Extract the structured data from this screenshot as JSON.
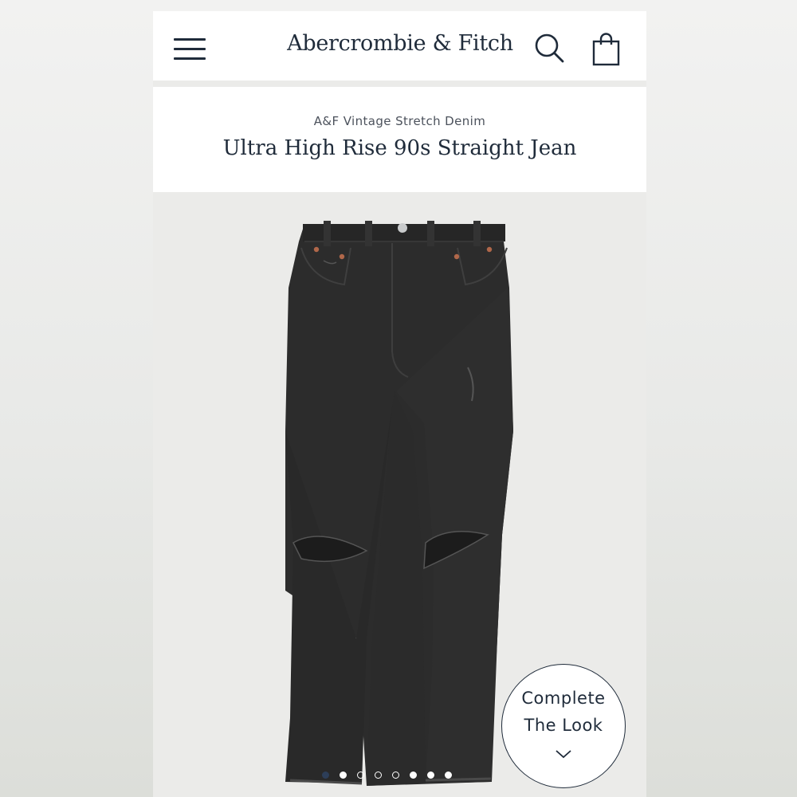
{
  "header": {
    "brand": "Abercrombie & Fitch",
    "icons": [
      "hamburger-menu-icon",
      "search-icon",
      "shopping-bag-icon"
    ]
  },
  "product": {
    "collection": "A&F Vintage Stretch Denim",
    "title": "Ultra High Rise 90s Straight Jean"
  },
  "complete_look": {
    "line1": "Complete",
    "line2": "The Look",
    "icon": "chevron-down-icon"
  },
  "carousel": {
    "total": 8,
    "active_index": 0
  },
  "colors": {
    "brand_navy": "#1f2b3a",
    "denim": "#2b2b2b",
    "background": "#ebebe9"
  }
}
